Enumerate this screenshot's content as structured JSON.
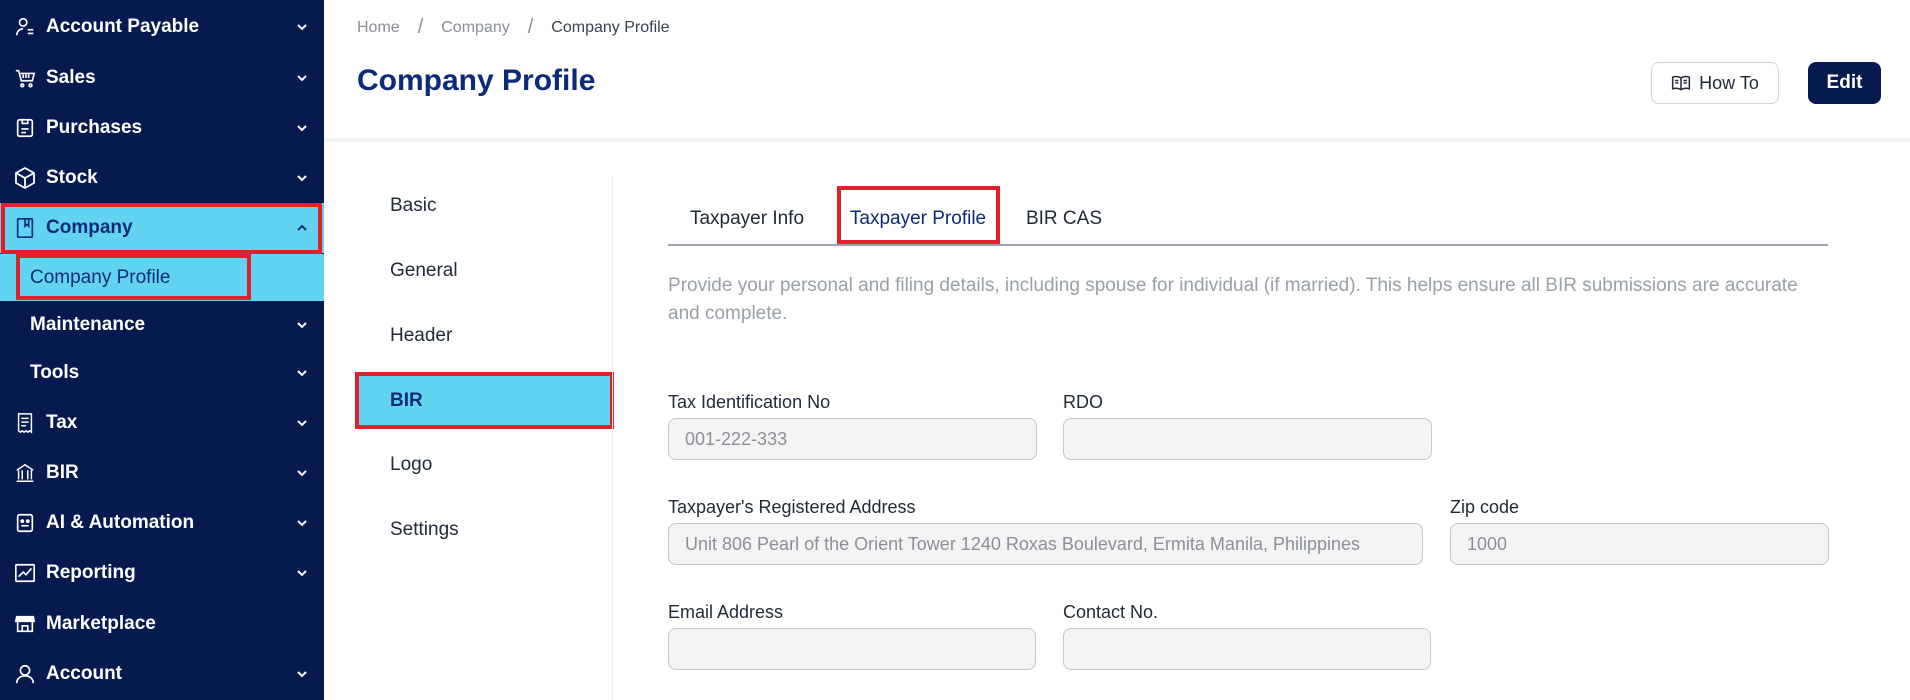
{
  "sidebar": {
    "items": [
      {
        "label": "Account Payable",
        "icon": "user-cash-icon"
      },
      {
        "label": "Sales",
        "icon": "cart-icon"
      },
      {
        "label": "Purchases",
        "icon": "clipboard-icon"
      },
      {
        "label": "Stock",
        "icon": "box-icon"
      },
      {
        "label": "Company",
        "icon": "bookmark-icon"
      },
      {
        "label": "Company Profile"
      },
      {
        "label": "Maintenance"
      },
      {
        "label": "Tools"
      },
      {
        "label": "Tax",
        "icon": "tax-receipt-icon"
      },
      {
        "label": "BIR",
        "icon": "building-icon"
      },
      {
        "label": "AI & Automation",
        "icon": "robot-icon"
      },
      {
        "label": "Reporting",
        "icon": "chart-line-icon"
      },
      {
        "label": "Marketplace",
        "icon": "store-icon"
      },
      {
        "label": "Account",
        "icon": "user-icon"
      }
    ]
  },
  "breadcrumb": {
    "home": "Home",
    "company": "Company",
    "current": "Company Profile",
    "separator": "/"
  },
  "header": {
    "title": "Company Profile",
    "howto_label": "How To",
    "edit_label": "Edit"
  },
  "sections": [
    "Basic",
    "General",
    "Header",
    "BIR",
    "Logo",
    "Settings"
  ],
  "tabs": [
    "Taxpayer Info",
    "Taxpayer Profile",
    "BIR CAS"
  ],
  "description": "Provide your personal and filing details, including spouse for individual (if married). This helps ensure all BIR submissions are accurate and complete.",
  "form": {
    "tin": {
      "label": "Tax Identification No",
      "placeholder": "001-222-333"
    },
    "rdo": {
      "label": "RDO",
      "placeholder": ""
    },
    "address": {
      "label": "Taxpayer's Registered Address",
      "placeholder": "Unit 806 Pearl of the Orient Tower 1240 Roxas Boulevard, Ermita Manila, Philippines"
    },
    "zip": {
      "label": "Zip code",
      "placeholder": "1000"
    },
    "email": {
      "label": "Email Address",
      "placeholder": ""
    },
    "contact": {
      "label": "Contact No.",
      "placeholder": ""
    }
  },
  "colors": {
    "sidebar_bg": "#061a4f",
    "active_bg": "#62d3f0",
    "primary": "#0b2a78",
    "highlight": "#e0202a"
  }
}
